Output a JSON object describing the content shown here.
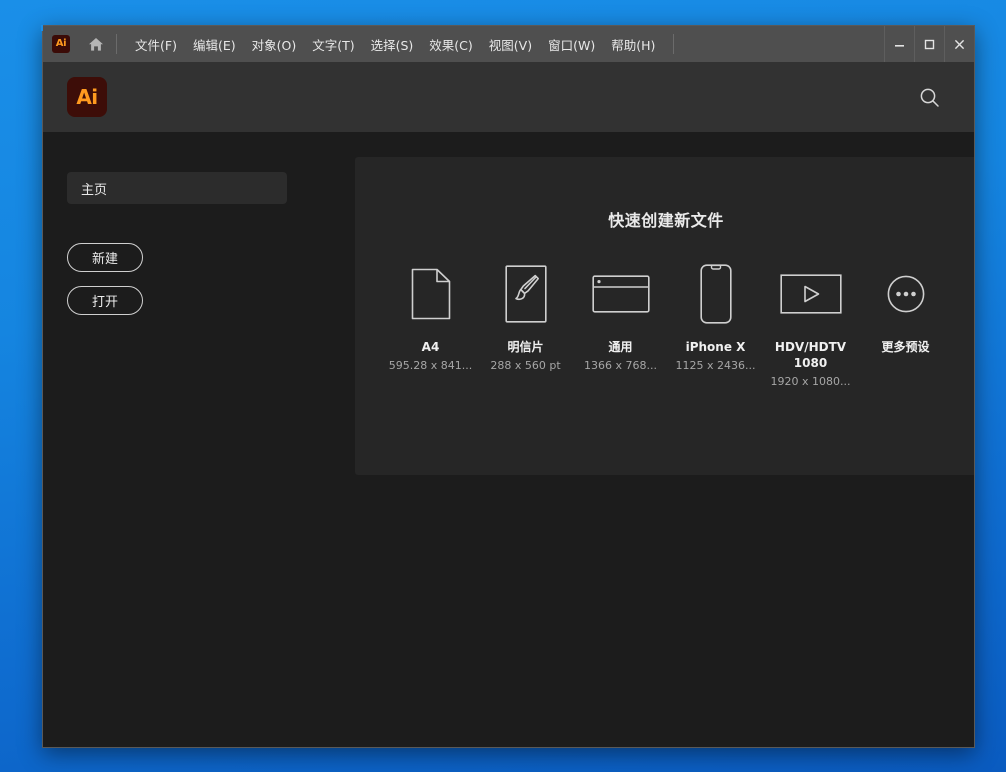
{
  "titlebar": {
    "app_badge": "Ai",
    "home_icon": "home-icon",
    "menus": [
      "文件(F)",
      "编辑(E)",
      "对象(O)",
      "文字(T)",
      "选择(S)",
      "效果(C)",
      "视图(V)",
      "窗口(W)",
      "帮助(H)"
    ],
    "window_controls": {
      "minimize": "minimize-icon",
      "maximize": "maximize-icon",
      "close": "close-icon"
    }
  },
  "header": {
    "logo_text": "Ai",
    "search_icon": "search-icon"
  },
  "sidebar": {
    "home_tab_label": "主页",
    "new_button_label": "新建",
    "open_button_label": "打开"
  },
  "main": {
    "panel_title": "快速创建新文件",
    "presets": [
      {
        "name": "A4",
        "size": "595.28 x 841...",
        "icon": "document-page-icon"
      },
      {
        "name": "明信片",
        "size": "288 x 560 pt",
        "icon": "paintbrush-icon"
      },
      {
        "name": "通用",
        "size": "1366 x 768...",
        "icon": "browser-window-icon"
      },
      {
        "name": "iPhone X",
        "size": "1125 x 2436...",
        "icon": "phone-icon"
      },
      {
        "name": "HDV/HDTV 1080",
        "size": "1920 x 1080...",
        "icon": "video-play-icon"
      },
      {
        "name": "更多预设",
        "size": "",
        "icon": "ellipsis-circle-icon"
      }
    ]
  },
  "colors": {
    "brand_orange": "#ff9a1f",
    "brand_dark_red": "#3d0d08",
    "panel_bg": "#262626",
    "body_bg": "#1c1c1c",
    "header_bg": "#323232",
    "titlebar_bg": "#4f4f4f",
    "desktop_blue": "#1585e0"
  }
}
